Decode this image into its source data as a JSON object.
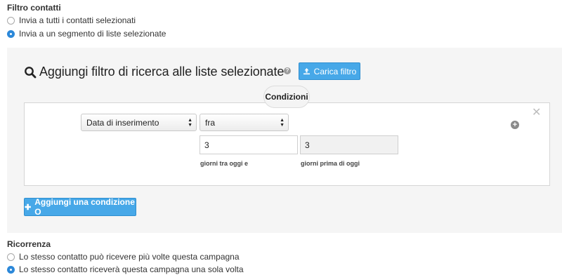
{
  "filtro": {
    "title": "Filtro contatti",
    "options": [
      {
        "label": "Invia a tutti i contatti selezionati",
        "checked": false
      },
      {
        "label": "Invia a un segmento di liste selezionate",
        "checked": true
      }
    ]
  },
  "search_filter": {
    "title": "Aggiungi filtro di ricerca alle liste selezionate",
    "help": "?",
    "load_button": "Carica filtro",
    "conditions_label": "Condizioni",
    "condition": {
      "field": "Data di inserimento",
      "operator": "fra",
      "value_1": "3",
      "value_2": "3",
      "hint_1": "giorni tra oggi e",
      "hint_2": "giorni prima di oggi"
    },
    "add_condition_button": "Aggiungi una condizione O"
  },
  "ricorrenza": {
    "title": "Ricorrenza",
    "options": [
      {
        "label": "Lo stesso contatto può ricevere più volte questa campagna",
        "checked": false
      },
      {
        "label": "Lo stesso contatto riceverà questa campagna una sola volta",
        "checked": true
      }
    ]
  },
  "colors": {
    "accent": "#47a8e8",
    "radio_checked": "#2c88d9",
    "panel_bg": "#f5f5f5"
  }
}
